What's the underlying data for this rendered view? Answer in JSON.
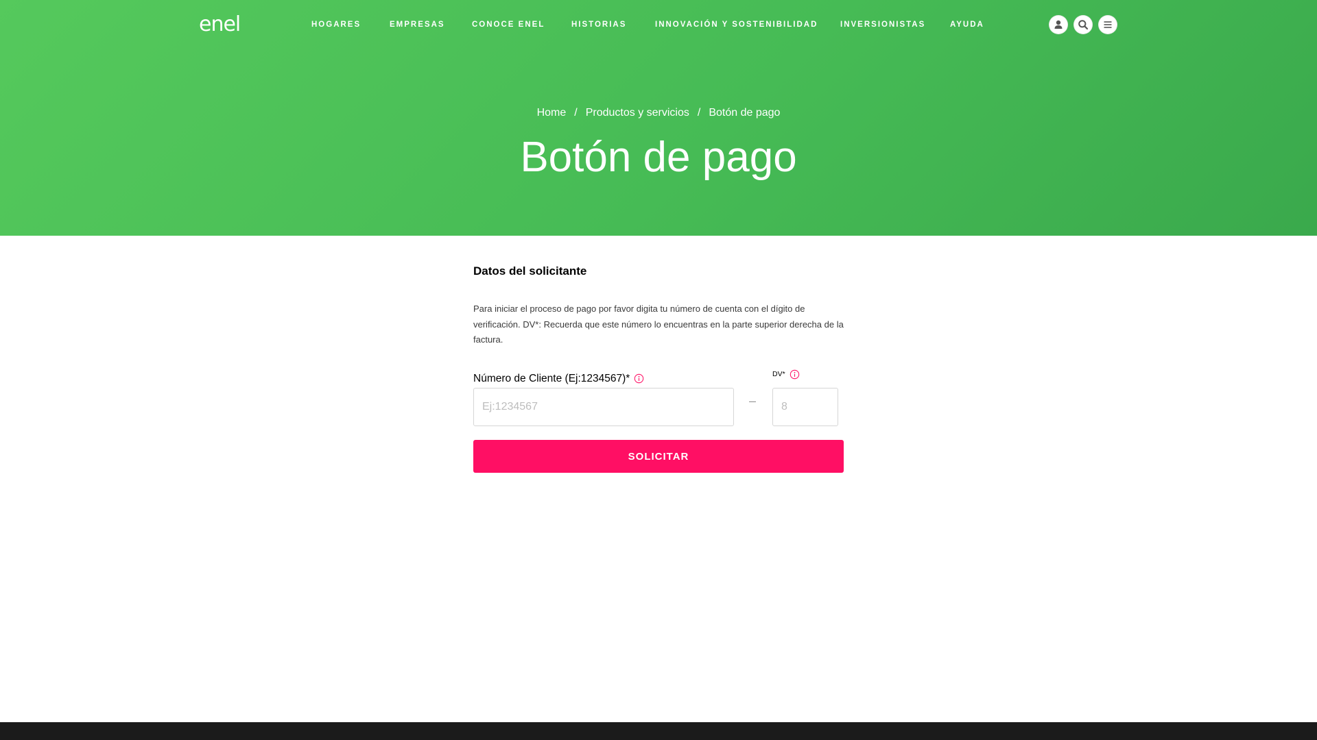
{
  "brand": {
    "logo_text": "enel"
  },
  "nav": {
    "items": [
      {
        "label": "HOGARES"
      },
      {
        "label": "EMPRESAS"
      },
      {
        "label": "CONOCE ENEL"
      },
      {
        "label": "HISTORIAS"
      },
      {
        "label": "INNOVACIÓN Y SOSTENIBILIDAD"
      },
      {
        "label": "INVERSIONISTAS"
      },
      {
        "label": "AYUDA"
      }
    ],
    "icons": [
      "user-icon",
      "search-icon",
      "menu-icon"
    ]
  },
  "breadcrumb": {
    "items": [
      {
        "label": "Home"
      },
      {
        "label": "Productos y servicios"
      },
      {
        "label": "Botón de pago"
      }
    ],
    "separator": "/"
  },
  "page": {
    "title": "Botón de pago"
  },
  "form": {
    "section_title": "Datos del solicitante",
    "description": "Para iniciar el proceso de pago por favor digita tu número de cuenta con el dígito de verificación. DV*: Recuerda que este número lo encuentras en la parte superior derecha de la factura.",
    "client_label": "Número de Cliente (Ej:1234567)*",
    "client_placeholder": "Ej:1234567",
    "client_value": "",
    "dash": "–",
    "dv_label": "DV*",
    "dv_placeholder": "8",
    "dv_value": "",
    "submit_label": "SOLICITAR"
  },
  "colors": {
    "hero_green": "#46bb55",
    "accent_pink": "#ff0f64",
    "footer_dark": "#1b1b1b"
  }
}
